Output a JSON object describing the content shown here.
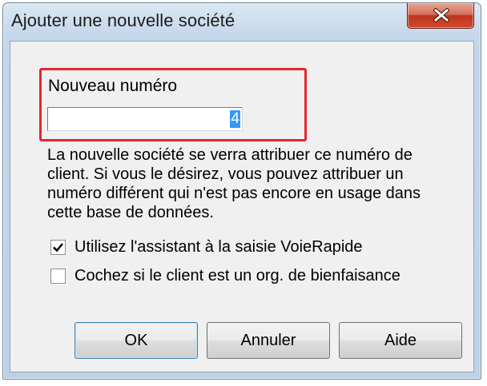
{
  "window": {
    "title": "Ajouter une nouvelle société"
  },
  "form": {
    "new_number_label": "Nouveau numéro",
    "new_number_value": "4",
    "info_text": "La nouvelle société se verra attribuer ce numéro de client. Si vous le désirez, vous pouvez attribuer un numéro différent qui n'est pas encore en usage dans cette base de données."
  },
  "checkboxes": [
    {
      "label": "Utilisez l'assistant à la saisie VoieRapide",
      "checked": true
    },
    {
      "label": "Cochez si le client est un org. de bienfaisance",
      "checked": false
    }
  ],
  "buttons": {
    "ok": "OK",
    "cancel": "Annuler",
    "help": "Aide"
  },
  "colors": {
    "highlight": "#e7252b",
    "selection": "#3399ff",
    "close_button": "#c7462b"
  },
  "icons": {
    "close": "close-icon",
    "check": "check-icon"
  }
}
